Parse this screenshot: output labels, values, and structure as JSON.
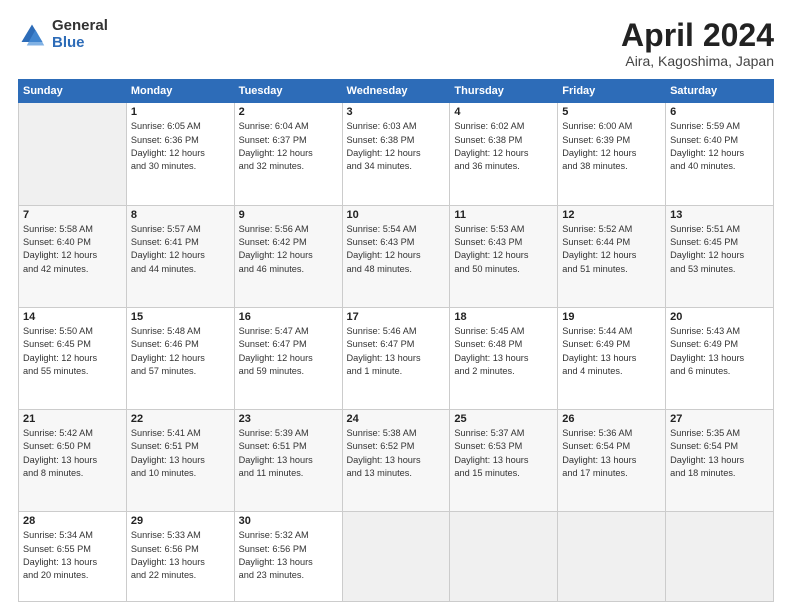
{
  "header": {
    "logo_general": "General",
    "logo_blue": "Blue",
    "month_title": "April 2024",
    "subtitle": "Aira, Kagoshima, Japan"
  },
  "columns": [
    "Sunday",
    "Monday",
    "Tuesday",
    "Wednesday",
    "Thursday",
    "Friday",
    "Saturday"
  ],
  "weeks": [
    [
      {
        "day": "",
        "info": ""
      },
      {
        "day": "1",
        "info": "Sunrise: 6:05 AM\nSunset: 6:36 PM\nDaylight: 12 hours\nand 30 minutes."
      },
      {
        "day": "2",
        "info": "Sunrise: 6:04 AM\nSunset: 6:37 PM\nDaylight: 12 hours\nand 32 minutes."
      },
      {
        "day": "3",
        "info": "Sunrise: 6:03 AM\nSunset: 6:38 PM\nDaylight: 12 hours\nand 34 minutes."
      },
      {
        "day": "4",
        "info": "Sunrise: 6:02 AM\nSunset: 6:38 PM\nDaylight: 12 hours\nand 36 minutes."
      },
      {
        "day": "5",
        "info": "Sunrise: 6:00 AM\nSunset: 6:39 PM\nDaylight: 12 hours\nand 38 minutes."
      },
      {
        "day": "6",
        "info": "Sunrise: 5:59 AM\nSunset: 6:40 PM\nDaylight: 12 hours\nand 40 minutes."
      }
    ],
    [
      {
        "day": "7",
        "info": "Sunrise: 5:58 AM\nSunset: 6:40 PM\nDaylight: 12 hours\nand 42 minutes."
      },
      {
        "day": "8",
        "info": "Sunrise: 5:57 AM\nSunset: 6:41 PM\nDaylight: 12 hours\nand 44 minutes."
      },
      {
        "day": "9",
        "info": "Sunrise: 5:56 AM\nSunset: 6:42 PM\nDaylight: 12 hours\nand 46 minutes."
      },
      {
        "day": "10",
        "info": "Sunrise: 5:54 AM\nSunset: 6:43 PM\nDaylight: 12 hours\nand 48 minutes."
      },
      {
        "day": "11",
        "info": "Sunrise: 5:53 AM\nSunset: 6:43 PM\nDaylight: 12 hours\nand 50 minutes."
      },
      {
        "day": "12",
        "info": "Sunrise: 5:52 AM\nSunset: 6:44 PM\nDaylight: 12 hours\nand 51 minutes."
      },
      {
        "day": "13",
        "info": "Sunrise: 5:51 AM\nSunset: 6:45 PM\nDaylight: 12 hours\nand 53 minutes."
      }
    ],
    [
      {
        "day": "14",
        "info": "Sunrise: 5:50 AM\nSunset: 6:45 PM\nDaylight: 12 hours\nand 55 minutes."
      },
      {
        "day": "15",
        "info": "Sunrise: 5:48 AM\nSunset: 6:46 PM\nDaylight: 12 hours\nand 57 minutes."
      },
      {
        "day": "16",
        "info": "Sunrise: 5:47 AM\nSunset: 6:47 PM\nDaylight: 12 hours\nand 59 minutes."
      },
      {
        "day": "17",
        "info": "Sunrise: 5:46 AM\nSunset: 6:47 PM\nDaylight: 13 hours\nand 1 minute."
      },
      {
        "day": "18",
        "info": "Sunrise: 5:45 AM\nSunset: 6:48 PM\nDaylight: 13 hours\nand 2 minutes."
      },
      {
        "day": "19",
        "info": "Sunrise: 5:44 AM\nSunset: 6:49 PM\nDaylight: 13 hours\nand 4 minutes."
      },
      {
        "day": "20",
        "info": "Sunrise: 5:43 AM\nSunset: 6:49 PM\nDaylight: 13 hours\nand 6 minutes."
      }
    ],
    [
      {
        "day": "21",
        "info": "Sunrise: 5:42 AM\nSunset: 6:50 PM\nDaylight: 13 hours\nand 8 minutes."
      },
      {
        "day": "22",
        "info": "Sunrise: 5:41 AM\nSunset: 6:51 PM\nDaylight: 13 hours\nand 10 minutes."
      },
      {
        "day": "23",
        "info": "Sunrise: 5:39 AM\nSunset: 6:51 PM\nDaylight: 13 hours\nand 11 minutes."
      },
      {
        "day": "24",
        "info": "Sunrise: 5:38 AM\nSunset: 6:52 PM\nDaylight: 13 hours\nand 13 minutes."
      },
      {
        "day": "25",
        "info": "Sunrise: 5:37 AM\nSunset: 6:53 PM\nDaylight: 13 hours\nand 15 minutes."
      },
      {
        "day": "26",
        "info": "Sunrise: 5:36 AM\nSunset: 6:54 PM\nDaylight: 13 hours\nand 17 minutes."
      },
      {
        "day": "27",
        "info": "Sunrise: 5:35 AM\nSunset: 6:54 PM\nDaylight: 13 hours\nand 18 minutes."
      }
    ],
    [
      {
        "day": "28",
        "info": "Sunrise: 5:34 AM\nSunset: 6:55 PM\nDaylight: 13 hours\nand 20 minutes."
      },
      {
        "day": "29",
        "info": "Sunrise: 5:33 AM\nSunset: 6:56 PM\nDaylight: 13 hours\nand 22 minutes."
      },
      {
        "day": "30",
        "info": "Sunrise: 5:32 AM\nSunset: 6:56 PM\nDaylight: 13 hours\nand 23 minutes."
      },
      {
        "day": "",
        "info": ""
      },
      {
        "day": "",
        "info": ""
      },
      {
        "day": "",
        "info": ""
      },
      {
        "day": "",
        "info": ""
      }
    ]
  ]
}
